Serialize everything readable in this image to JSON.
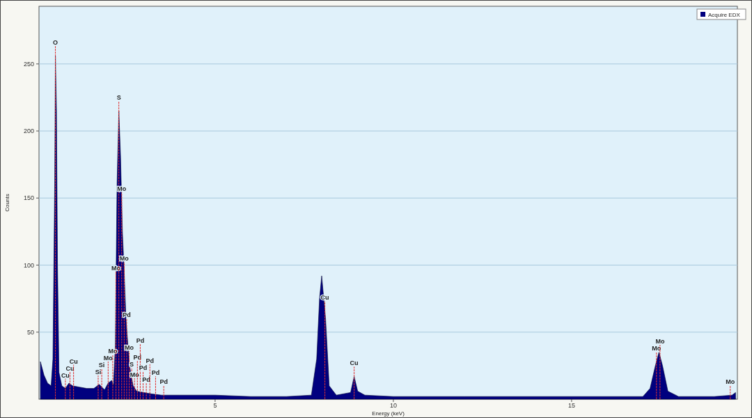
{
  "chart": {
    "chart_data": {
      "type": "area",
      "xlabel": "Energy (keV)",
      "ylabel": "Counts",
      "xlim": [
        0.06,
        19.65
      ],
      "ylim": [
        0,
        293
      ],
      "xticks": [
        5,
        10,
        15
      ],
      "yticks": [
        50,
        100,
        150,
        200,
        250
      ],
      "grid": true,
      "x": [
        0.1,
        0.2,
        0.3,
        0.4,
        0.45,
        0.5,
        0.52,
        0.55,
        0.58,
        0.62,
        0.7,
        0.8,
        0.9,
        1.0,
        1.2,
        1.4,
        1.6,
        1.75,
        1.9,
        2.0,
        2.1,
        2.15,
        2.2,
        2.25,
        2.3,
        2.35,
        2.4,
        2.45,
        2.5,
        2.6,
        2.7,
        2.8,
        3.0,
        3.2,
        3.5,
        4.0,
        5,
        6,
        7,
        7.7,
        7.85,
        7.93,
        7.99,
        8.1,
        8.2,
        8.4,
        8.8,
        8.9,
        9.0,
        9.2,
        10,
        12,
        15,
        17,
        17.2,
        17.35,
        17.45,
        17.55,
        17.7,
        18,
        19,
        19.5,
        19.6
      ],
      "series": [
        {
          "name": "Acquire EDX",
          "color": "#00007f",
          "values": [
            28,
            18,
            12,
            10,
            30,
            160,
            256,
            215,
            100,
            20,
            10,
            8,
            12,
            10,
            9,
            8,
            8,
            11,
            7,
            12,
            14,
            10,
            40,
            160,
            215,
            180,
            125,
            95,
            60,
            25,
            10,
            6,
            5,
            4,
            3,
            3,
            3,
            2,
            2,
            3,
            30,
            75,
            92,
            60,
            10,
            3,
            5,
            17,
            6,
            3,
            2,
            2,
            2,
            2,
            8,
            25,
            35,
            25,
            6,
            2,
            2,
            3,
            5
          ]
        }
      ],
      "ref_lines": [
        {
          "axis": "x",
          "value": 0.52,
          "label": "O"
        },
        {
          "axis": "x",
          "value": 0.8,
          "label": "Cu"
        },
        {
          "axis": "x",
          "value": 0.93,
          "label": "Cu"
        },
        {
          "axis": "x",
          "value": 1.03,
          "label": "Cu"
        },
        {
          "axis": "x",
          "value": 1.72,
          "label": "Si"
        },
        {
          "axis": "x",
          "value": 1.82,
          "label": "Si"
        },
        {
          "axis": "x",
          "value": 2.0,
          "label": "Mo"
        },
        {
          "axis": "x",
          "value": 2.13,
          "label": "Mo"
        },
        {
          "axis": "x",
          "value": 2.22,
          "label": "Mo"
        },
        {
          "axis": "x",
          "value": 2.3,
          "label": "S"
        },
        {
          "axis": "x",
          "value": 2.38,
          "label": "Mo"
        },
        {
          "axis": "x",
          "value": 2.45,
          "label": "Mo"
        },
        {
          "axis": "x",
          "value": 2.52,
          "label": "Pd"
        },
        {
          "axis": "x",
          "value": 2.59,
          "label": "Mo"
        },
        {
          "axis": "x",
          "value": 2.66,
          "label": "S"
        },
        {
          "axis": "x",
          "value": 2.74,
          "label": "Mo"
        },
        {
          "axis": "x",
          "value": 2.82,
          "label": "Pd"
        },
        {
          "axis": "x",
          "value": 2.9,
          "label": "Pd"
        },
        {
          "axis": "x",
          "value": 2.98,
          "label": "Pd"
        },
        {
          "axis": "x",
          "value": 3.07,
          "label": "Pd"
        },
        {
          "axis": "x",
          "value": 3.17,
          "label": "Pd"
        },
        {
          "axis": "x",
          "value": 3.33,
          "label": "Pd"
        },
        {
          "axis": "x",
          "value": 3.56,
          "label": "Pd"
        },
        {
          "axis": "x",
          "value": 8.08,
          "label": "Cu"
        },
        {
          "axis": "x",
          "value": 8.9,
          "label": "Cu"
        },
        {
          "axis": "x",
          "value": 17.38,
          "label": "Mo"
        },
        {
          "axis": "x",
          "value": 17.48,
          "label": "Mo"
        },
        {
          "axis": "x",
          "value": 19.45,
          "label": "Mo"
        }
      ]
    }
  }
}
